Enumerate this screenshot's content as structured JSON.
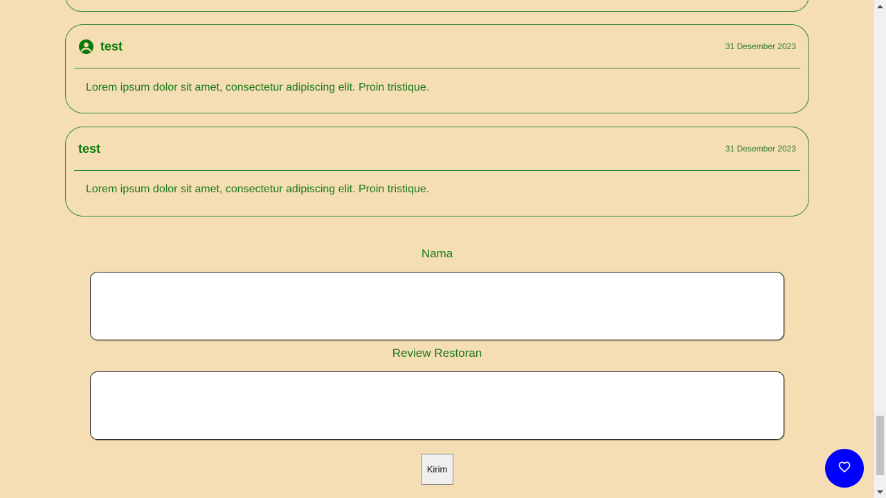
{
  "reviews": [
    {
      "name": "test",
      "date": "31 Desember 2023",
      "text": "Lorem ipsum dolor sit amet, consectetur adipiscing elit. Proin tristique.",
      "has_icon": true
    },
    {
      "name": "test",
      "date": "31 Desember 2023",
      "text": "Lorem ipsum dolor sit amet, consectetur adipiscing elit. Proin tristique.",
      "has_icon": false
    }
  ],
  "form": {
    "name_label": "Nama",
    "name_value": "",
    "review_label": "Review Restoran",
    "review_value": "",
    "submit_label": "Kirim"
  },
  "favorite_button": {
    "icon": "heart-icon",
    "color": "#0000ff"
  },
  "colors": {
    "background": "#f5deb3",
    "accent_text": "#0b7a0b"
  }
}
